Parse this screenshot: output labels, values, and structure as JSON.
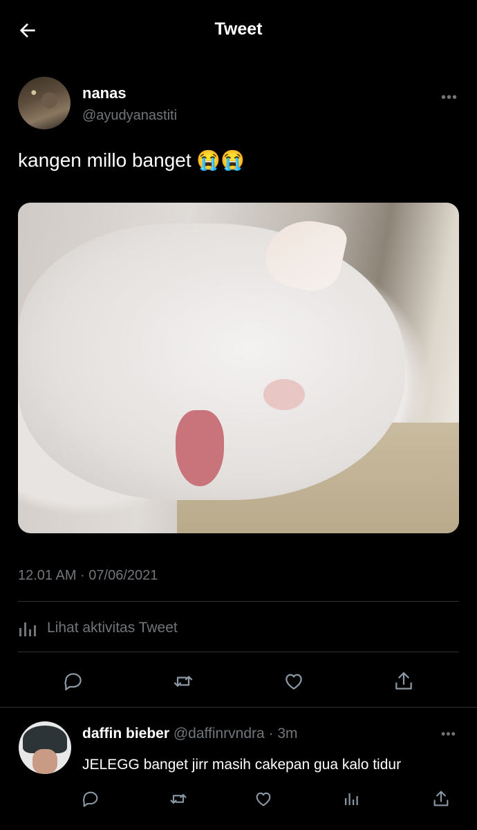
{
  "header": {
    "title": "Tweet",
    "back_icon": "arrow-left-icon"
  },
  "tweet": {
    "author": {
      "name": "nanas",
      "handle": "@ayudyanastiti"
    },
    "more_icon": "more-horizontal-icon",
    "more_label": "•••",
    "text": "kangen millo banget 😭😭",
    "media": {
      "description_icon": "photo-sleeping-white-cat"
    },
    "timestamp": "12.01 AM · 07/06/2021",
    "activity_label": "Lihat aktivitas Tweet",
    "actions": [
      "reply-icon",
      "retweet-icon",
      "like-icon",
      "share-icon"
    ]
  },
  "reply": {
    "author": {
      "name": "daffin bieber",
      "handle": "@daffinrvndra",
      "time": " · 3m"
    },
    "more_label": "•••",
    "text": "JELEGG banget jirr masih cakepan gua kalo tidur",
    "actions": [
      "reply-icon",
      "retweet-icon",
      "like-icon",
      "analytics-icon",
      "share-icon"
    ]
  },
  "colors": {
    "background": "#000000",
    "text": "#e7e9ea",
    "muted": "#71767b",
    "divider": "#2f3336"
  }
}
